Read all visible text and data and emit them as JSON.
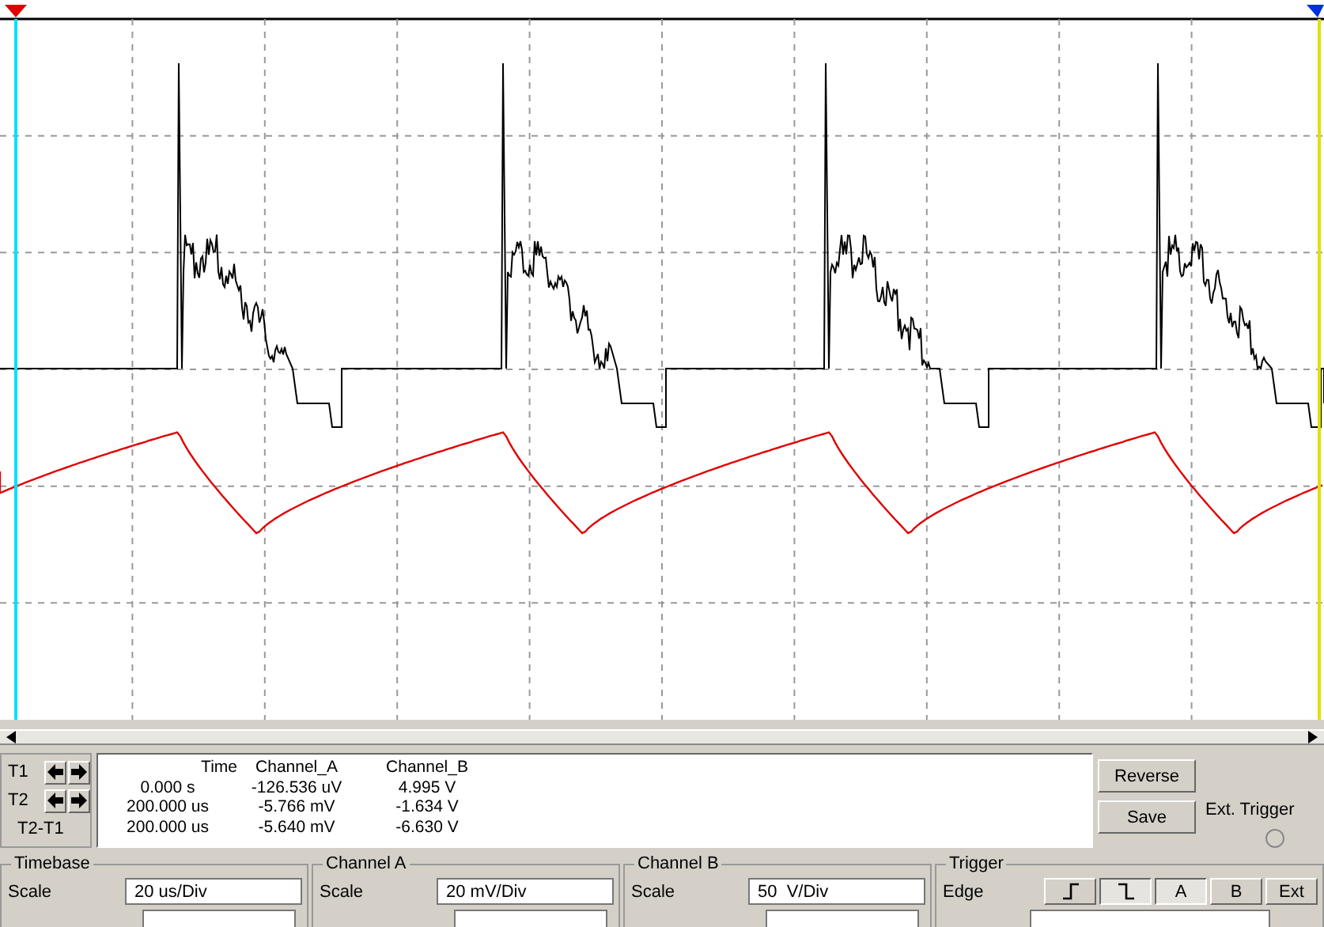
{
  "display": {
    "kind": "picture"
  },
  "readout": {
    "labels": [
      {
        "text": "T1",
        "kind": "arrows"
      },
      {
        "text": "T2",
        "kind": "arrows"
      },
      {
        "text": "T2-T1",
        "kind": "plain"
      }
    ],
    "columns": [
      "Time",
      "Channel_A",
      "Channel_B"
    ],
    "rows": [
      [
        "0.000 s",
        "-126.536 uV",
        "4.995 V"
      ],
      [
        "200.000 us",
        "-5.766 mV",
        "-1.634 V"
      ],
      [
        "200.000 us",
        "-5.640 mV",
        "-6.630 V"
      ]
    ]
  },
  "buttons": [
    "Reverse",
    "Save"
  ],
  "ext_trigger": {
    "label": "Ext. Trigger",
    "selected": false
  },
  "timebase": {
    "title": "Timebase",
    "label": "Scale",
    "value": "20 us/Div"
  },
  "channel_a": {
    "title": "Channel A",
    "label": "Scale",
    "value": "20 mV/Div"
  },
  "channel_b": {
    "title": "Channel B",
    "label": "Scale",
    "value": "50  V/Div"
  },
  "trigger": {
    "title": "Trigger",
    "label": "Edge",
    "edges": [
      {
        "kind": "rising",
        "selected": false
      },
      {
        "kind": "falling",
        "selected": true
      }
    ],
    "sources": [
      {
        "label": "A",
        "selected": true
      },
      {
        "label": "B",
        "selected": false
      },
      {
        "label": "Ext",
        "selected": false
      }
    ]
  }
}
